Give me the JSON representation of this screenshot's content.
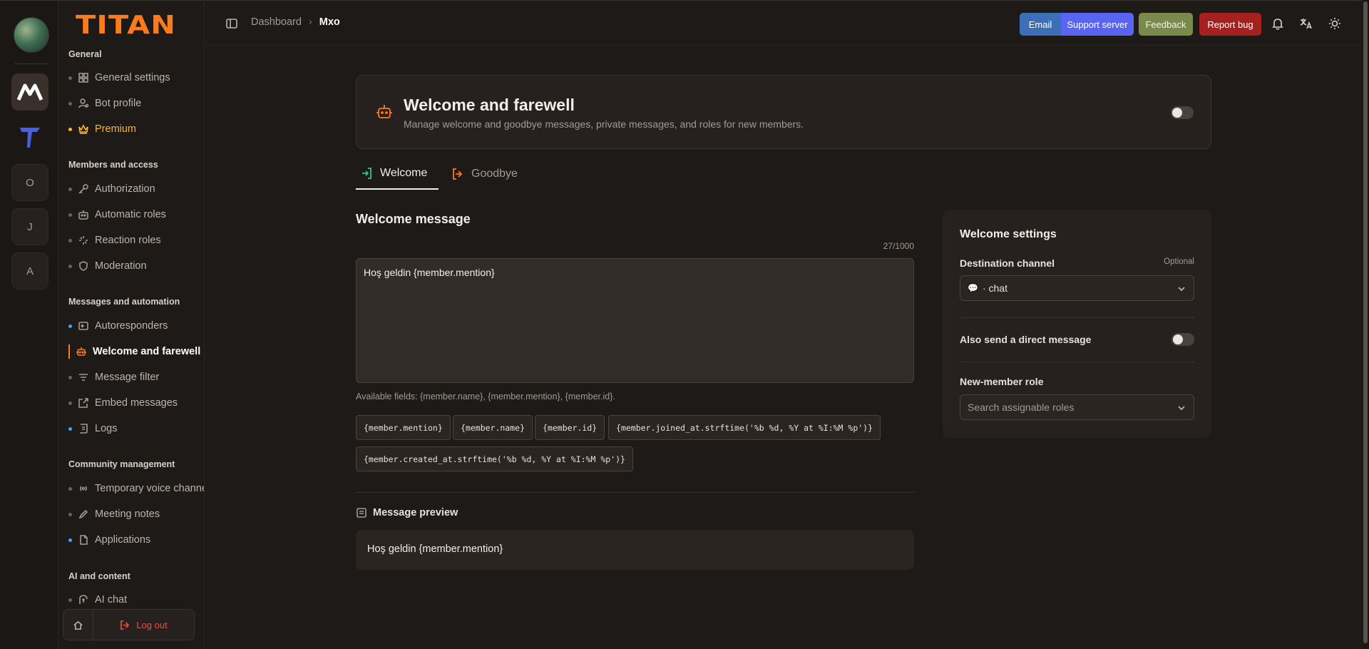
{
  "app": {
    "logo_text": "TITAN"
  },
  "servers": [
    {
      "label": "O"
    },
    {
      "label": "J"
    },
    {
      "label": "A"
    }
  ],
  "sidebar": {
    "sections": [
      {
        "title": "General",
        "items": [
          "General settings",
          "Bot profile",
          "Premium"
        ]
      },
      {
        "title": "Members and access",
        "items": [
          "Authorization",
          "Automatic roles",
          "Reaction roles",
          "Moderation"
        ]
      },
      {
        "title": "Messages and automation",
        "items": [
          "Autoresponders",
          "Welcome and farewell",
          "Message filter",
          "Embed messages",
          "Logs"
        ]
      },
      {
        "title": "Community management",
        "items": [
          "Temporary voice channels",
          "Meeting notes",
          "Applications"
        ]
      },
      {
        "title": "AI and content",
        "items": [
          "AI chat"
        ]
      }
    ],
    "logout_label": "Log out"
  },
  "topbar": {
    "breadcrumb": [
      "Dashboard",
      "Mxo"
    ],
    "buttons": {
      "email": "Email",
      "support": "Support server",
      "feedback": "Feedback",
      "report": "Report bug"
    }
  },
  "page": {
    "title": "Welcome and farewell",
    "subtitle": "Manage welcome and goodbye messages, private messages, and roles for new members.",
    "enabled": false,
    "tabs": [
      "Welcome",
      "Goodbye"
    ],
    "active_tab": "Welcome"
  },
  "welcome": {
    "section_title": "Welcome message",
    "counter": "27/1000",
    "message": "Hoş geldin {member.mention}",
    "fields_hint": "Available fields: {member.name}, {member.mention}, {member.id}.",
    "chips": [
      "{member.mention}",
      "{member.name}",
      "{member.id}",
      "{member.joined_at.strftime('%b %d, %Y at %I:%M %p')}",
      "{member.created_at.strftime('%b %d, %Y at %I:%M %p')}"
    ],
    "preview_label": "Message preview",
    "preview_text": "Hoş geldin {member.mention}"
  },
  "settings": {
    "title": "Welcome settings",
    "destination_label": "Destination channel",
    "destination_optional": "Optional",
    "destination_value": "· chat",
    "dm_label": "Also send a direct message",
    "dm_enabled": false,
    "role_label": "New-member role",
    "role_placeholder": "Search assignable roles"
  },
  "colors": {
    "accent": "#ff7a1a",
    "premium": "#f5b53a",
    "welcome_tab_icon": "#24c6a0",
    "support_button": "#5865f2",
    "feedback_button": "#7a8a4a",
    "report_button": "#a6201f"
  }
}
